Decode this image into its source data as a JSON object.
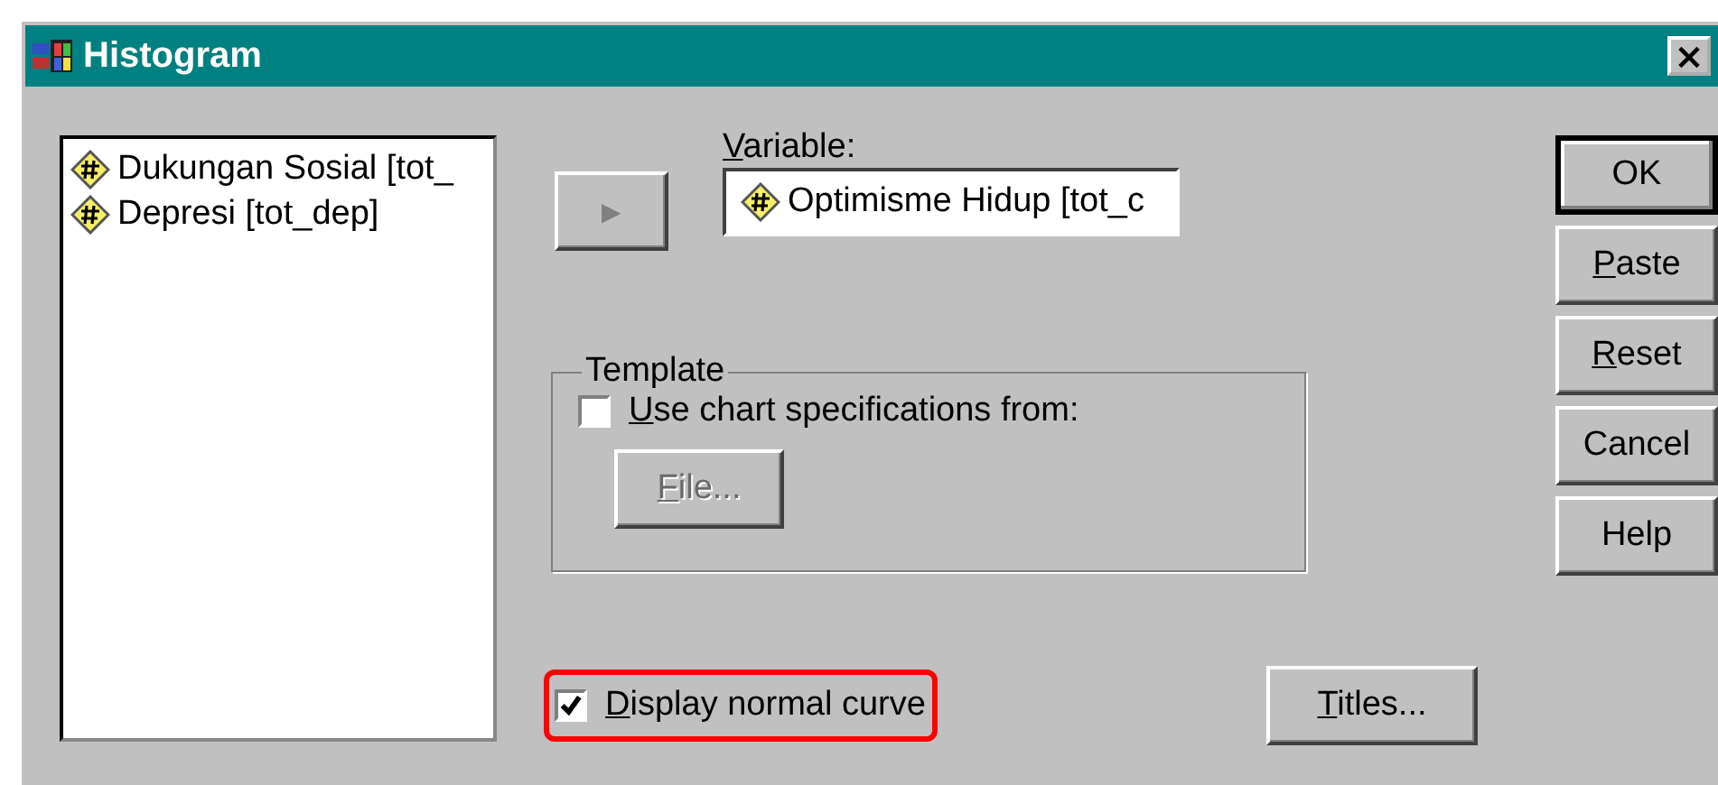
{
  "window": {
    "title": "Histogram",
    "close": "×"
  },
  "source_list": {
    "items": [
      {
        "label": "Dukungan Sosial [tot_",
        "selected": false
      },
      {
        "label": "Depresi [tot_dep]",
        "selected": false
      }
    ]
  },
  "move_button": {
    "glyph": "▶",
    "disabled": true
  },
  "variable": {
    "label": "Variable:",
    "underline_first": true,
    "value": "Optimisme Hidup [tot_c"
  },
  "template": {
    "title": "Template",
    "checkbox": {
      "label": "Use chart specifications from:",
      "underline_first": true,
      "checked": false
    },
    "file_button": {
      "label": "File...",
      "underline_first": true,
      "disabled": true
    }
  },
  "normal_curve": {
    "label": "Display normal curve",
    "underline_first": true,
    "checked": true,
    "highlighted": true
  },
  "titles_button": {
    "label": "Titles...",
    "underline_first": true
  },
  "buttons": [
    {
      "label": "OK",
      "underline_first": false,
      "default": true
    },
    {
      "label": "Paste",
      "underline_first": true,
      "default": false
    },
    {
      "label": "Reset",
      "underline_first": true,
      "default": false
    },
    {
      "label": "Cancel",
      "underline_first": false,
      "default": false
    },
    {
      "label": "Help",
      "underline_first": false,
      "default": false
    }
  ]
}
